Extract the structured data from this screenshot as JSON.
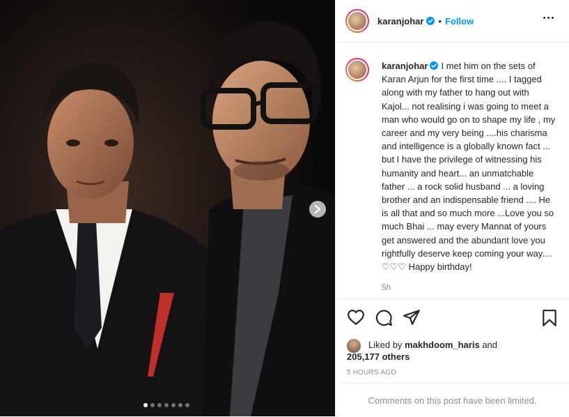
{
  "post": {
    "username": "karanjohar",
    "follow_label": "Follow",
    "separator": "•",
    "caption": "I met him on the sets of Karan Arjun for the first time .... I tagged along with my father to hang out with Kajol... not realising i was going to meet a man who would go on to shape my life , my career and my very being ....his charisma and intelligence is a globally known fact ... but I have the privilege of witnessing his humanity and heart... an unmatchable father ... a rock solid husband ... a loving brother and an indispensable friend .... He is all that and so much more ...Love you so much Bhai ... may every Mannat of yours get answered and the abundant love you rightfully deserve keep coming your way.... ♡♡♡ Happy birthday!",
    "time_short": "5h",
    "liked_prefix": "Liked by",
    "liked_user": "makhdoom_haris",
    "liked_and": "and",
    "likes_count": "205,177 others",
    "time_ago": "5 HOURS AGO",
    "comments_notice": "Comments on this post have been limited."
  },
  "carousel": {
    "total_slides": 7,
    "current_slide": 1
  },
  "icons": [
    "verified-badge-icon",
    "more-options-icon",
    "like-heart-icon",
    "comment-icon",
    "share-icon",
    "save-bookmark-icon",
    "next-arrow-icon"
  ],
  "colors": {
    "accent": "#0095f6",
    "text": "#262626",
    "muted": "#8e8e8e",
    "border": "#efefef"
  }
}
